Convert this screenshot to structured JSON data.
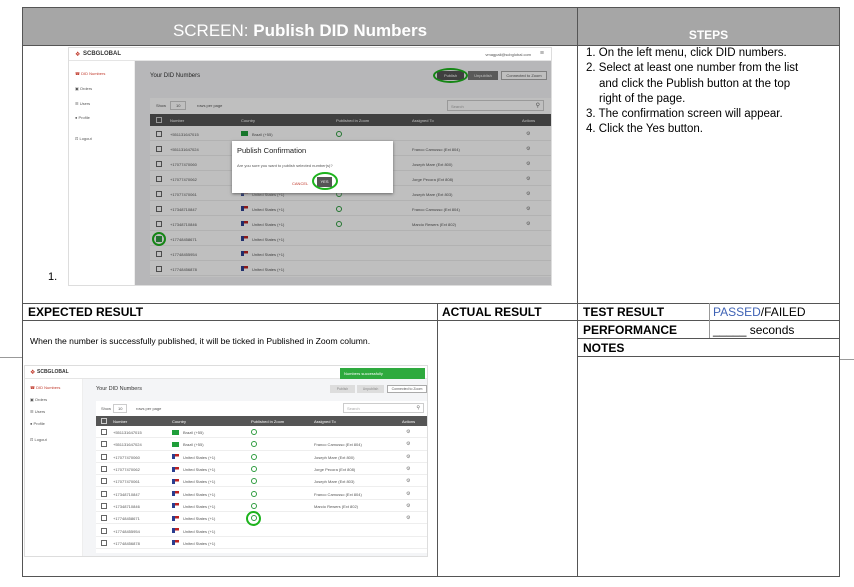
{
  "screen_header": {
    "prefix": "SCREEN: ",
    "title": "Publish DID Numbers"
  },
  "steps_header": "STEPS",
  "steps": [
    "1. On the left menu, click DID numbers.",
    "2. Select at least one number from the list",
    "and click the Publish button at the top",
    "right of the page.",
    "3. The confirmation screen will appear.",
    "4. Click the Yes button."
  ],
  "step_label": "1.",
  "expected_header": "EXPECTED RESULT",
  "actual_header": "ACTUAL RESULT",
  "test_result_label": "TEST RESULT",
  "test_result_passed": "PASSED",
  "test_result_sep": "/",
  "test_result_failed": "FAILED",
  "performance_label": "PERFORMANCE",
  "performance_value": "_____ seconds",
  "notes_label": "NOTES",
  "expected_text": "When the number is successfully published, it will be ticked in Published in Zoom column.",
  "app": {
    "logo": "SCBGLOBAL",
    "user_email": "vmagpali@scbglobal.com",
    "menu": [
      "DID Numbers",
      "Orders",
      "Users",
      "Profile",
      "Logout"
    ],
    "page_title": "Your DID Numbers",
    "btn_publish": "Publish",
    "btn_unpublish": "Unpublish",
    "btn_zoom": "Connected to Zoom",
    "show_label": "Show",
    "show_value": "10",
    "per_page": "rows per page",
    "search_placeholder": "Search",
    "columns": [
      "Number",
      "Country",
      "Published in Zoom",
      "Assigned To",
      "Actions"
    ],
    "rows": [
      {
        "number": "+551131647015",
        "country": "Brazil (+55)",
        "assigned": ""
      },
      {
        "number": "+551131647024",
        "country": "Brazil (+55)",
        "assigned": "Franco Camusso (Ext 804)"
      },
      {
        "number": "+17077470060",
        "country": "United States (+1)",
        "assigned": "Joseph Mare (Ext 800)"
      },
      {
        "number": "+17077470062",
        "country": "United States (+1)",
        "assigned": "Jorge Pecora (Ext 808)"
      },
      {
        "number": "+17077470061",
        "country": "United States (+1)",
        "assigned": "Joseph Mare (Ext 803)"
      },
      {
        "number": "+17348710847",
        "country": "United States (+1)",
        "assigned": "Franco Camusso (Ext 804)"
      },
      {
        "number": "+17348710846",
        "country": "United States (+1)",
        "assigned": "Marcio Rewers (Ext 802)"
      },
      {
        "number": "+17748458671",
        "country": "United States (+1)",
        "assigned": ""
      },
      {
        "number": "+17748455954",
        "country": "United States (+1)",
        "assigned": ""
      },
      {
        "number": "+17748456878",
        "country": "United States (+1)",
        "assigned": ""
      }
    ],
    "dialog_title": "Publish Confirmation",
    "dialog_text": "Are you sure you want to publish selected number(s)?",
    "dialog_cancel": "CANCEL",
    "dialog_yes": "YES",
    "toast": "Numbers successfully"
  }
}
